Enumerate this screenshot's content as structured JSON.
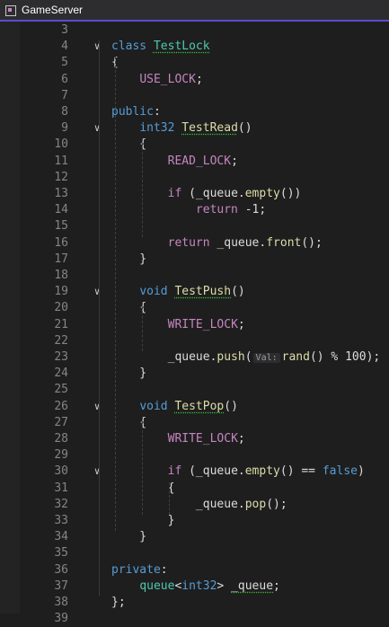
{
  "window": {
    "title": "GameServer"
  },
  "editor": {
    "lines": [
      {
        "num": "3",
        "fold": "",
        "segments": []
      },
      {
        "num": "4",
        "fold": "chevron-down",
        "segments": [
          {
            "t": "class ",
            "c": "kw"
          },
          {
            "t": "TestLock",
            "c": "ty sq"
          }
        ]
      },
      {
        "num": "5",
        "fold": "",
        "segments": [
          {
            "t": "{",
            "c": ""
          }
        ]
      },
      {
        "num": "6",
        "fold": "",
        "segments": [
          {
            "t": "    ",
            "c": ""
          },
          {
            "t": "USE_LOCK",
            "c": "mac"
          },
          {
            "t": ";",
            "c": ""
          }
        ]
      },
      {
        "num": "7",
        "fold": "",
        "segments": []
      },
      {
        "num": "8",
        "fold": "",
        "segments": [
          {
            "t": "public",
            "c": "kw"
          },
          {
            "t": ":",
            "c": ""
          }
        ]
      },
      {
        "num": "9",
        "fold": "chevron-down",
        "segments": [
          {
            "t": "    ",
            "c": ""
          },
          {
            "t": "int32",
            "c": "kw"
          },
          {
            "t": " ",
            "c": ""
          },
          {
            "t": "TestRead",
            "c": "fn sq"
          },
          {
            "t": "()",
            "c": ""
          }
        ]
      },
      {
        "num": "10",
        "fold": "",
        "segments": [
          {
            "t": "    {",
            "c": ""
          }
        ]
      },
      {
        "num": "11",
        "fold": "",
        "segments": [
          {
            "t": "        ",
            "c": ""
          },
          {
            "t": "READ_LOCK",
            "c": "mac"
          },
          {
            "t": ";",
            "c": ""
          }
        ]
      },
      {
        "num": "12",
        "fold": "",
        "segments": []
      },
      {
        "num": "13",
        "fold": "",
        "segments": [
          {
            "t": "        ",
            "c": ""
          },
          {
            "t": "if",
            "c": "mac"
          },
          {
            "t": " (_queue.",
            "c": ""
          },
          {
            "t": "empty",
            "c": "fn"
          },
          {
            "t": "())",
            "c": ""
          }
        ]
      },
      {
        "num": "14",
        "fold": "",
        "segments": [
          {
            "t": "            ",
            "c": ""
          },
          {
            "t": "return",
            "c": "mac"
          },
          {
            "t": " -1;",
            "c": ""
          }
        ]
      },
      {
        "num": "15",
        "fold": "",
        "segments": []
      },
      {
        "num": "16",
        "fold": "",
        "segments": [
          {
            "t": "        ",
            "c": ""
          },
          {
            "t": "return",
            "c": "mac"
          },
          {
            "t": " _queue.",
            "c": ""
          },
          {
            "t": "front",
            "c": "fn"
          },
          {
            "t": "();",
            "c": ""
          }
        ]
      },
      {
        "num": "17",
        "fold": "",
        "segments": [
          {
            "t": "    }",
            "c": ""
          }
        ]
      },
      {
        "num": "18",
        "fold": "",
        "segments": []
      },
      {
        "num": "19",
        "fold": "chevron-down",
        "segments": [
          {
            "t": "    ",
            "c": ""
          },
          {
            "t": "void",
            "c": "kw"
          },
          {
            "t": " ",
            "c": ""
          },
          {
            "t": "TestPush",
            "c": "fn sq"
          },
          {
            "t": "()",
            "c": ""
          }
        ]
      },
      {
        "num": "20",
        "fold": "",
        "segments": [
          {
            "t": "    {",
            "c": ""
          }
        ]
      },
      {
        "num": "21",
        "fold": "",
        "segments": [
          {
            "t": "        ",
            "c": ""
          },
          {
            "t": "WRITE_LOCK",
            "c": "mac"
          },
          {
            "t": ";",
            "c": ""
          }
        ]
      },
      {
        "num": "22",
        "fold": "",
        "segments": []
      },
      {
        "num": "23",
        "fold": "",
        "segments": [
          {
            "t": "        _queue.",
            "c": ""
          },
          {
            "t": "push",
            "c": "fn"
          },
          {
            "t": "(",
            "c": ""
          },
          {
            "t": "Val:",
            "c": "hint"
          },
          {
            "t": "rand",
            "c": "fn"
          },
          {
            "t": "() % 100);",
            "c": ""
          }
        ]
      },
      {
        "num": "24",
        "fold": "",
        "segments": [
          {
            "t": "    }",
            "c": ""
          }
        ]
      },
      {
        "num": "25",
        "fold": "",
        "segments": []
      },
      {
        "num": "26",
        "fold": "chevron-down",
        "segments": [
          {
            "t": "    ",
            "c": ""
          },
          {
            "t": "void",
            "c": "kw"
          },
          {
            "t": " ",
            "c": ""
          },
          {
            "t": "TestPop",
            "c": "fn sq"
          },
          {
            "t": "()",
            "c": ""
          }
        ]
      },
      {
        "num": "27",
        "fold": "",
        "segments": [
          {
            "t": "    {",
            "c": ""
          }
        ]
      },
      {
        "num": "28",
        "fold": "",
        "segments": [
          {
            "t": "        ",
            "c": ""
          },
          {
            "t": "WRITE_LOCK",
            "c": "mac"
          },
          {
            "t": ";",
            "c": ""
          }
        ]
      },
      {
        "num": "29",
        "fold": "",
        "segments": []
      },
      {
        "num": "30",
        "fold": "chevron-down",
        "segments": [
          {
            "t": "        ",
            "c": ""
          },
          {
            "t": "if",
            "c": "mac"
          },
          {
            "t": " (_queue.",
            "c": ""
          },
          {
            "t": "empty",
            "c": "fn"
          },
          {
            "t": "() == ",
            "c": ""
          },
          {
            "t": "false",
            "c": "kw"
          },
          {
            "t": ")",
            "c": ""
          }
        ]
      },
      {
        "num": "31",
        "fold": "",
        "segments": [
          {
            "t": "        {",
            "c": ""
          }
        ]
      },
      {
        "num": "32",
        "fold": "",
        "segments": [
          {
            "t": "            _queue.",
            "c": ""
          },
          {
            "t": "pop",
            "c": "fn"
          },
          {
            "t": "();",
            "c": ""
          }
        ]
      },
      {
        "num": "33",
        "fold": "",
        "segments": [
          {
            "t": "        }",
            "c": ""
          }
        ]
      },
      {
        "num": "34",
        "fold": "",
        "segments": [
          {
            "t": "    }",
            "c": ""
          }
        ]
      },
      {
        "num": "35",
        "fold": "",
        "segments": []
      },
      {
        "num": "36",
        "fold": "",
        "segments": [
          {
            "t": "private",
            "c": "kw"
          },
          {
            "t": ":",
            "c": ""
          }
        ]
      },
      {
        "num": "37",
        "fold": "",
        "segments": [
          {
            "t": "    ",
            "c": ""
          },
          {
            "t": "queue",
            "c": "ty"
          },
          {
            "t": "<",
            "c": ""
          },
          {
            "t": "int32",
            "c": "kw"
          },
          {
            "t": "> ",
            "c": ""
          },
          {
            "t": "_queue",
            "c": "sq"
          },
          {
            "t": ";",
            "c": ""
          }
        ]
      },
      {
        "num": "38",
        "fold": "",
        "segments": [
          {
            "t": "};",
            "c": ""
          }
        ]
      },
      {
        "num": "39",
        "fold": "",
        "segments": []
      }
    ]
  }
}
